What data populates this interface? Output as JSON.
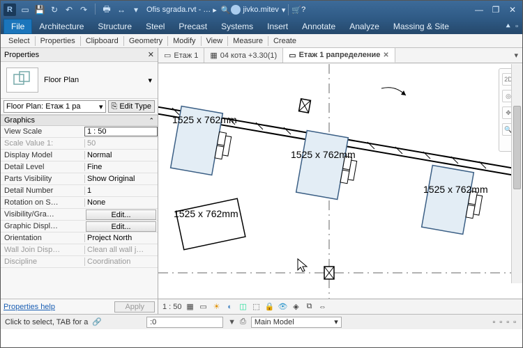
{
  "app": {
    "logo_letter": "R",
    "doc_title": "Ofis sgrada.rvt - …",
    "username": "jivko.mitev"
  },
  "ribbon": {
    "tabs": [
      "File",
      "Architecture",
      "Structure",
      "Steel",
      "Precast",
      "Systems",
      "Insert",
      "Annotate",
      "Analyze",
      "Massing & Site"
    ]
  },
  "options": [
    "Select",
    "Properties",
    "Clipboard",
    "Geometry",
    "Modify",
    "View",
    "Measure",
    "Create"
  ],
  "properties": {
    "panel_title": "Properties",
    "type_name": "Floor Plan",
    "instance_dd": "Floor Plan: Етаж 1 ра",
    "edit_type": "Edit Type",
    "group": "Graphics",
    "rows": [
      {
        "label": "View Scale",
        "value": "1 : 50",
        "kind": "box"
      },
      {
        "label": "Scale Value   1:",
        "value": "50",
        "kind": "gray"
      },
      {
        "label": "Display Model",
        "value": "Normal",
        "kind": "text"
      },
      {
        "label": "Detail Level",
        "value": "Fine",
        "kind": "text"
      },
      {
        "label": "Parts Visibility",
        "value": "Show Original",
        "kind": "text"
      },
      {
        "label": "Detail Number",
        "value": "1",
        "kind": "text"
      },
      {
        "label": "Rotation on S…",
        "value": "None",
        "kind": "text"
      },
      {
        "label": "Visibility/Gra…",
        "value": "Edit...",
        "kind": "btn"
      },
      {
        "label": "Graphic Displ…",
        "value": "Edit...",
        "kind": "btn"
      },
      {
        "label": "Orientation",
        "value": "Project North",
        "kind": "text"
      },
      {
        "label": "Wall Join Disp…",
        "value": "Clean all wall j…",
        "kind": "gray"
      },
      {
        "label": "Discipline",
        "value": "Coordination",
        "kind": "gray"
      }
    ],
    "help": "Properties help",
    "apply": "Apply"
  },
  "views": {
    "tabs": [
      {
        "label": "Етаж 1",
        "active": false
      },
      {
        "label": "04 кота +3.30(1)",
        "active": false
      },
      {
        "label": "Етаж 1 рапределение",
        "active": true
      }
    ]
  },
  "canvas": {
    "desk_label": "1525 x 762mm",
    "scale": "1 : 50"
  },
  "status": {
    "hint": "Click to select, TAB for a",
    "filter_label": ":0",
    "model_dd": "Main Model"
  }
}
